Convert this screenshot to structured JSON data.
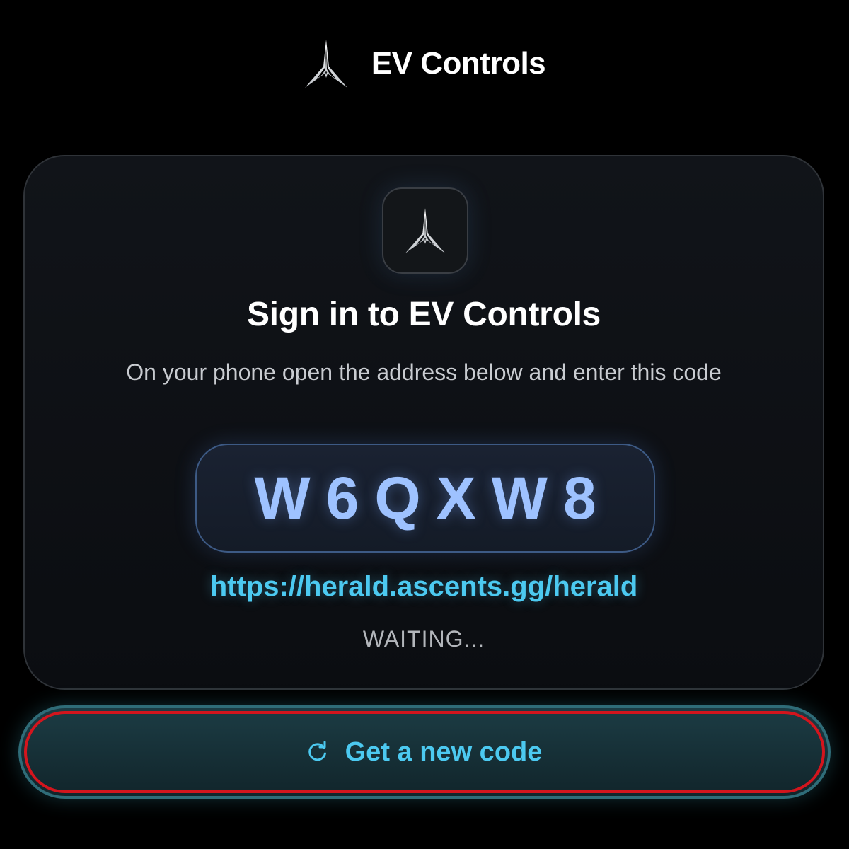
{
  "header": {
    "logo_icon": "ev-controls-logo-icon",
    "title": "EV Controls"
  },
  "card": {
    "app_icon": "ev-controls-logo-icon",
    "title": "Sign in to EV Controls",
    "instructions": "On your phone open the address below and enter this code",
    "code": "W6QXW8",
    "url": "https://herald.ascents.gg/herald",
    "status": "WAITING..."
  },
  "button": {
    "icon": "refresh-icon",
    "label": "Get a new code"
  },
  "colors": {
    "background": "#000000",
    "code_text": "#9ec2ff",
    "link": "#4cc9f0",
    "button_outline_highlight": "#d3151d"
  }
}
